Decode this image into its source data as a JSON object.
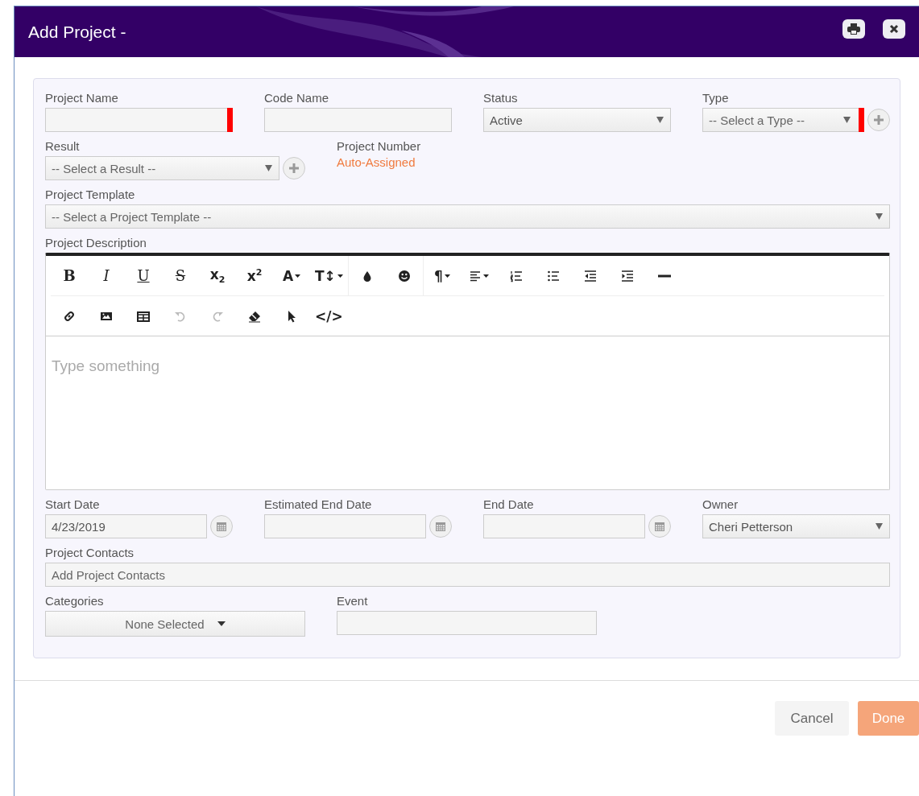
{
  "dialog": {
    "title": "Add Project -"
  },
  "form": {
    "rows": [
      {
        "fields": [
          {
            "label": "Project Name",
            "kind": "text",
            "required": true
          },
          {
            "label": "Code Name",
            "kind": "text"
          },
          {
            "label": "Status",
            "kind": "select",
            "value": "Active"
          },
          {
            "label": "Type",
            "kind": "select",
            "placeholder": "-- Select a Type --",
            "required": true,
            "add_button": true
          }
        ]
      },
      {
        "fields": [
          {
            "label": "Result",
            "kind": "select",
            "placeholder": "-- Select a Result --",
            "add_button": true
          },
          {
            "label": "Project Number",
            "kind": "static",
            "value": "Auto-Assigned"
          }
        ]
      },
      {
        "fields": [
          {
            "label": "Project Template",
            "kind": "select",
            "placeholder": "-- Select a Project Template --"
          }
        ]
      },
      {
        "fields": [
          {
            "label": "Project Description",
            "kind": "editor",
            "placeholder": "Type something"
          }
        ]
      },
      {
        "fields": [
          {
            "label": "Start Date",
            "kind": "date",
            "value": "4/23/2019"
          },
          {
            "label": "Estimated End Date",
            "kind": "date"
          },
          {
            "label": "End Date",
            "kind": "date"
          },
          {
            "label": "Owner",
            "kind": "select",
            "value": "Cheri Petterson"
          }
        ]
      },
      {
        "fields": [
          {
            "label": "Project Contacts",
            "kind": "text",
            "placeholder": "Add Project Contacts"
          }
        ]
      },
      {
        "fields": [
          {
            "label": "Categories",
            "kind": "multiselect",
            "value": "None Selected"
          },
          {
            "label": "Event",
            "kind": "text"
          }
        ]
      }
    ]
  },
  "toolbar": {
    "rows": [
      [
        [
          {
            "kind": "bold",
            "label": "B"
          },
          {
            "kind": "italic",
            "label": "I"
          },
          {
            "kind": "underline",
            "label": "U"
          },
          {
            "kind": "strike",
            "label": "S"
          },
          {
            "kind": "plain",
            "label": "x$_{2}$"
          },
          {
            "kind": "plain",
            "label": "x$^{2}$"
          },
          {
            "kind": "plain",
            "label": "A",
            "dropdown": true
          },
          {
            "kind": "plain",
            "label": "T↕",
            "dropdown": true
          }
        ],
        [
          {
            "kind": "drop"
          },
          {
            "kind": "smiley"
          }
        ],
        [
          {
            "kind": "plain",
            "label": "¶",
            "dropdown": true
          },
          {
            "kind": "align",
            "dropdown": true
          },
          {
            "kind": "ol"
          },
          {
            "kind": "ul"
          },
          {
            "kind": "outdent"
          },
          {
            "kind": "indent"
          },
          {
            "kind": "rule"
          }
        ]
      ],
      [
        [
          {
            "kind": "link"
          },
          {
            "kind": "image"
          },
          {
            "kind": "table"
          },
          {
            "kind": "undo",
            "disabled": true
          },
          {
            "kind": "redo",
            "disabled": true
          },
          {
            "kind": "eraser"
          },
          {
            "kind": "pointer"
          },
          {
            "kind": "plain",
            "label": "</>"
          }
        ]
      ]
    ]
  },
  "footer": {
    "buttons": [
      {
        "label": "Cancel",
        "kind": "secondary"
      },
      {
        "label": "Done",
        "kind": "primary"
      }
    ]
  }
}
